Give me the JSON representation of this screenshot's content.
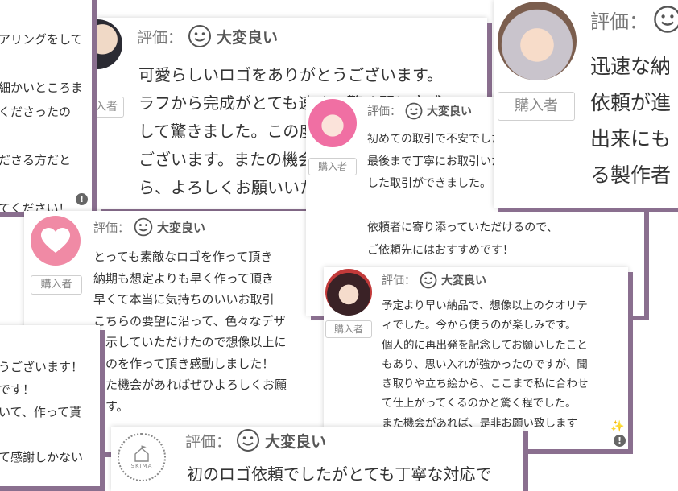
{
  "reviews": [
    {
      "text": "アリングをして\n\n細かいところま\nくださったの\n\nださる方だと\n\nてください！"
    },
    {
      "rating_label": "評価：",
      "rating_value": "大変良い",
      "buyer_tag": "入者",
      "text": "可愛らしいロゴをありがとうございます。\nラフから完成がとても速く、驚く間に完成\nして驚きました。この度はありがとう\nございます。またの機会がありました\nら、よろしくお願いいたします。"
    },
    {
      "rating_label": "評価：",
      "rating_value": "大変良い",
      "buyer_tag": "購入者",
      "text": "初めての取引で不安でしたが、\n最後まで丁寧にお取引いただき、安心\nした取引ができました。\n\n依頼者に寄り添っていただけるので、\nご依頼先にはおすすめです！"
    },
    {
      "rating_label": "評価：",
      "rating_value": "",
      "buyer_tag": "購入者",
      "text": "迅速な納\n依頼が進\n出来にも\nる製作者"
    },
    {
      "rating_label": "評価：",
      "rating_value": "大変良い",
      "buyer_tag": "購入者",
      "text": "とっても素敵なロゴを作って頂き\n納期も想定よりも早く作って頂き\n早くて本当に気持ちのいいお取引\nこちらの要望に沿って、色々なデザ\n提示していただけたので想像以上に\nものを作って頂き感動しました！\nまた機会があればぜひよろしくお願\nます。"
    },
    {
      "rating_label": "評価：",
      "rating_value": "大変良い",
      "buyer_tag": "購入者",
      "text": "予定より早い納品で、想像以上のクオリテ\nィでした。今から使うのが楽しみです。\n個人的に再出発を記念してお願いしたこと\nもあり、思い入れが強かったのですが、聞\nき取りや立ち絵から、ここまで私に合わせ\nて仕上がってくるのかと驚く程でした。\nまた機会があれば、是非お願い致します"
    },
    {
      "text": "うございます！\nです！\nいて、作って貰\n\nて感謝しかない"
    },
    {
      "rating_label": "評価：",
      "rating_value": "大変良い",
      "avatar_text": "SKIMA",
      "text": "初のロゴ依頼でしたがとても丁寧な対応で"
    }
  ],
  "icons": {
    "rating": "smiley-face-icon",
    "report": "exclamation-icon",
    "heart": "heart-icon",
    "sparkle": "sparkle-icon"
  },
  "colors": {
    "card_shadow": "#8a6f8f",
    "heart_avatar": "#f08aa5",
    "report_icon": "#666666"
  }
}
